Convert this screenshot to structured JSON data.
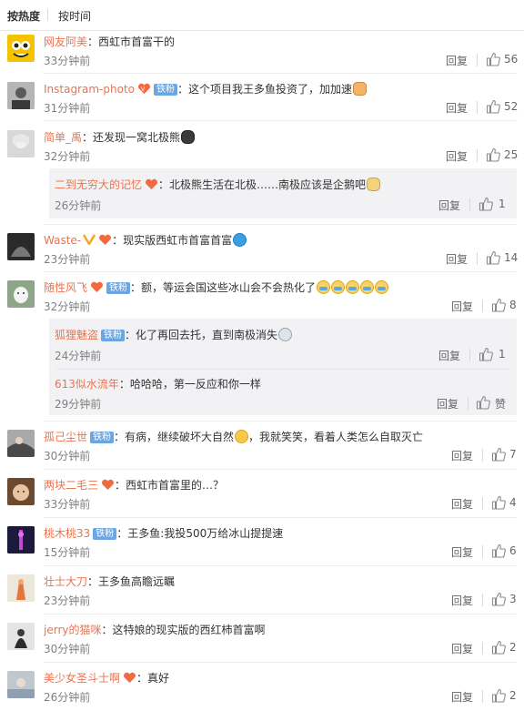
{
  "tabs": {
    "hot": "按热度",
    "time": "按时间"
  },
  "reply_label": "回复",
  "zan_label": "赞",
  "fan_badge": "铁粉",
  "colors": {
    "name": "#eb7350",
    "fan_badge": "#6ca6e2",
    "text": "#333333",
    "meta": "#808080"
  },
  "comments": [
    {
      "user": "网友阿美",
      "sep": "：",
      "text": "西虹市首富干的",
      "time": "33分钟前",
      "likes": "56"
    },
    {
      "user": "Instagram-photo",
      "sep": "：",
      "text": "这个项目我王多鱼投资了，加加速",
      "time": "31分钟前",
      "likes": "52"
    },
    {
      "user": "简单_禹",
      "sep": "：",
      "text": "还发现一窝北极熊",
      "time": "32分钟前",
      "likes": "25"
    },
    {
      "user": "Waste-",
      "sep": "：",
      "text": "现实版西虹市首富首富",
      "time": "23分钟前",
      "likes": "14"
    },
    {
      "user": "随性风飞",
      "sep": "：",
      "text": "额，等运会国这些冰山会不会热化了",
      "time": "32分钟前",
      "likes": "8"
    },
    {
      "user": "孤己尘世",
      "sep": "：",
      "text": "有病，继续破坏大自然",
      "text2": "，我就笑笑，看着人类怎么自取灭亡",
      "time": "30分钟前",
      "likes": "7"
    },
    {
      "user": "两块二毛三",
      "sep": "：",
      "text": "西虹市首富里的…？",
      "time": "33分钟前",
      "likes": "4"
    },
    {
      "user": "桃木桃33",
      "sep": "：",
      "text": "王多鱼:我投500万给冰山提提速",
      "time": "15分钟前",
      "likes": "6"
    },
    {
      "user": "壮士大刀",
      "sep": "：",
      "text": "王多鱼高瞻远瞩",
      "time": "23分钟前",
      "likes": "3"
    },
    {
      "user": "jerry的猫咪",
      "sep": "：",
      "text": "这特娘的现实版的西红柿首富啊",
      "time": "30分钟前",
      "likes": "2"
    },
    {
      "user": "美少女圣斗士啊",
      "sep": "：",
      "text": "真好",
      "time": "26分钟前",
      "likes": "2"
    }
  ],
  "replies": [
    {
      "user": "二到无穷大的记忆",
      "sep": "：",
      "text": "北极熊生活在北极……南极应该是企鹅吧",
      "time": "26分钟前",
      "likes": "1"
    },
    {
      "user": "狐狸魅盗",
      "sep": "：",
      "text": "化了再回去托，直到南极消失",
      "time": "24分钟前",
      "likes": "1"
    },
    {
      "user": "613似水流年",
      "sep": "：",
      "text": "哈哈哈，第一反应和你一样",
      "time": "29分钟前"
    }
  ]
}
